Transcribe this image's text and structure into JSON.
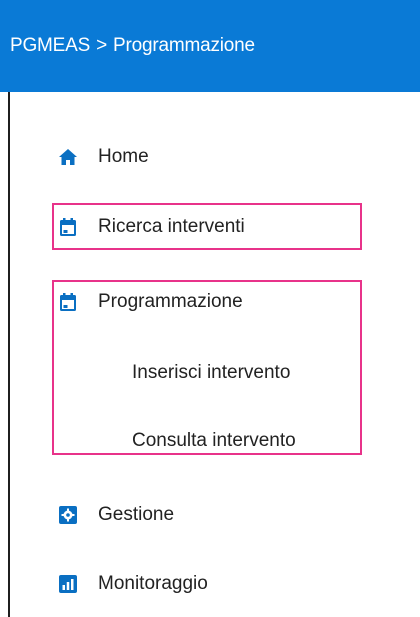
{
  "header": {
    "app": "PGMEAS",
    "separator": ">",
    "section": "Programmazione"
  },
  "menu": {
    "home": {
      "label": "Home",
      "icon": "home-icon"
    },
    "ricerca": {
      "label": "Ricerca interventi",
      "icon": "calendar-icon"
    },
    "programmazione": {
      "label": "Programmazione",
      "icon": "calendar-icon"
    },
    "inserisci": {
      "label": "Inserisci intervento"
    },
    "consulta": {
      "label": "Consulta intervento"
    },
    "gestione": {
      "label": "Gestione",
      "icon": "gear-icon"
    },
    "monitoraggio": {
      "label": "Monitoraggio",
      "icon": "bar-chart-icon"
    }
  },
  "colors": {
    "header_bg": "#0a7ad6",
    "icon": "#0a6fc2",
    "highlight": "#e8338a"
  }
}
